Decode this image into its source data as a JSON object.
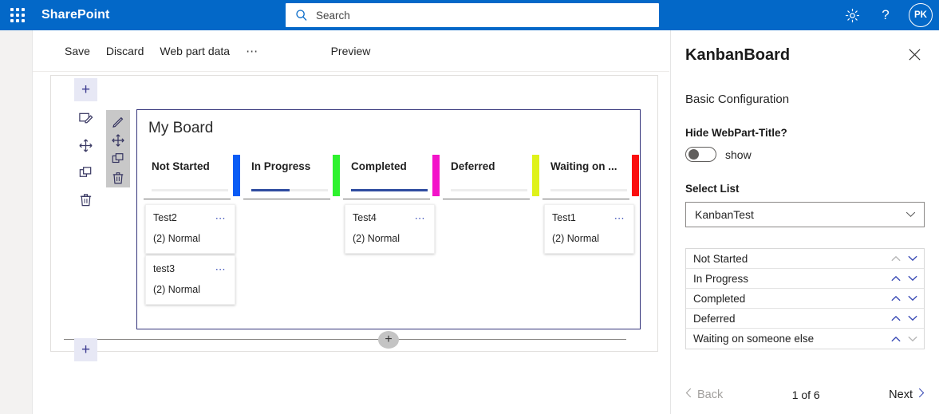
{
  "suite_bar": {
    "waffle_icon": "app-launcher-icon",
    "brand": "SharePoint",
    "search": {
      "icon": "search-icon",
      "placeholder": "Search",
      "value": ""
    },
    "settings_icon": "gear-icon",
    "help_label": "?",
    "avatar_initials": "PK"
  },
  "command_bar": {
    "save_label": "Save",
    "discard_label": "Discard",
    "webpart_data_label": "Web part data",
    "overflow_label": "⋯",
    "preview_label": "Preview"
  },
  "canvas_toolbar": {
    "add_label": "+",
    "items": [
      {
        "name": "edit-page-icon"
      },
      {
        "name": "move-icon"
      },
      {
        "name": "copy-icon"
      },
      {
        "name": "delete-icon"
      }
    ],
    "bottom_add_label": "+",
    "section_add_label": "+"
  },
  "webpart_toolbar": {
    "items": [
      {
        "name": "edit-icon"
      },
      {
        "name": "move-icon"
      },
      {
        "name": "copy-icon"
      },
      {
        "name": "delete-icon"
      }
    ]
  },
  "board": {
    "title": "My Board",
    "columns": [
      {
        "title": "Not Started",
        "bar_color": "#0a5cf5",
        "progress_percent": 0,
        "cards": [
          {
            "title": "Test2",
            "priority": "(2) Normal",
            "menu": "⋯"
          },
          {
            "title": "test3",
            "priority": "(2) Normal",
            "menu": "⋯"
          }
        ]
      },
      {
        "title": "In Progress",
        "bar_color": "#2ef22e",
        "progress_percent": 50,
        "cards": []
      },
      {
        "title": "Completed",
        "bar_color": "#f313c9",
        "progress_percent": 100,
        "cards": [
          {
            "title": "Test4",
            "priority": "(2) Normal",
            "menu": "⋯"
          }
        ]
      },
      {
        "title": "Deferred",
        "bar_color": "#dff21a",
        "progress_percent": 0,
        "cards": []
      },
      {
        "title": "Waiting on ...",
        "bar_color": "#fa0f0f",
        "progress_percent": 0,
        "cards": [
          {
            "title": "Test1",
            "priority": "(2) Normal",
            "menu": "⋯"
          }
        ]
      }
    ]
  },
  "pane": {
    "title": "KanbanBoard",
    "close_icon": "close-icon",
    "section_heading": "Basic Configuration",
    "hide_title_label": "Hide WebPart-Title?",
    "toggle_state_label": "show",
    "toggle_on": false,
    "select_list_label": "Select List",
    "select_list_value": "KanbanTest",
    "status_rows": [
      {
        "name": "Not Started",
        "up_enabled": false,
        "down_enabled": true
      },
      {
        "name": "In Progress",
        "up_enabled": true,
        "down_enabled": true
      },
      {
        "name": "Completed",
        "up_enabled": true,
        "down_enabled": true
      },
      {
        "name": "Deferred",
        "up_enabled": true,
        "down_enabled": true
      },
      {
        "name": "Waiting on someone else",
        "up_enabled": true,
        "down_enabled": false
      }
    ],
    "nav": {
      "back_label": "Back",
      "count_label": "1 of 6",
      "next_label": "Next"
    }
  }
}
